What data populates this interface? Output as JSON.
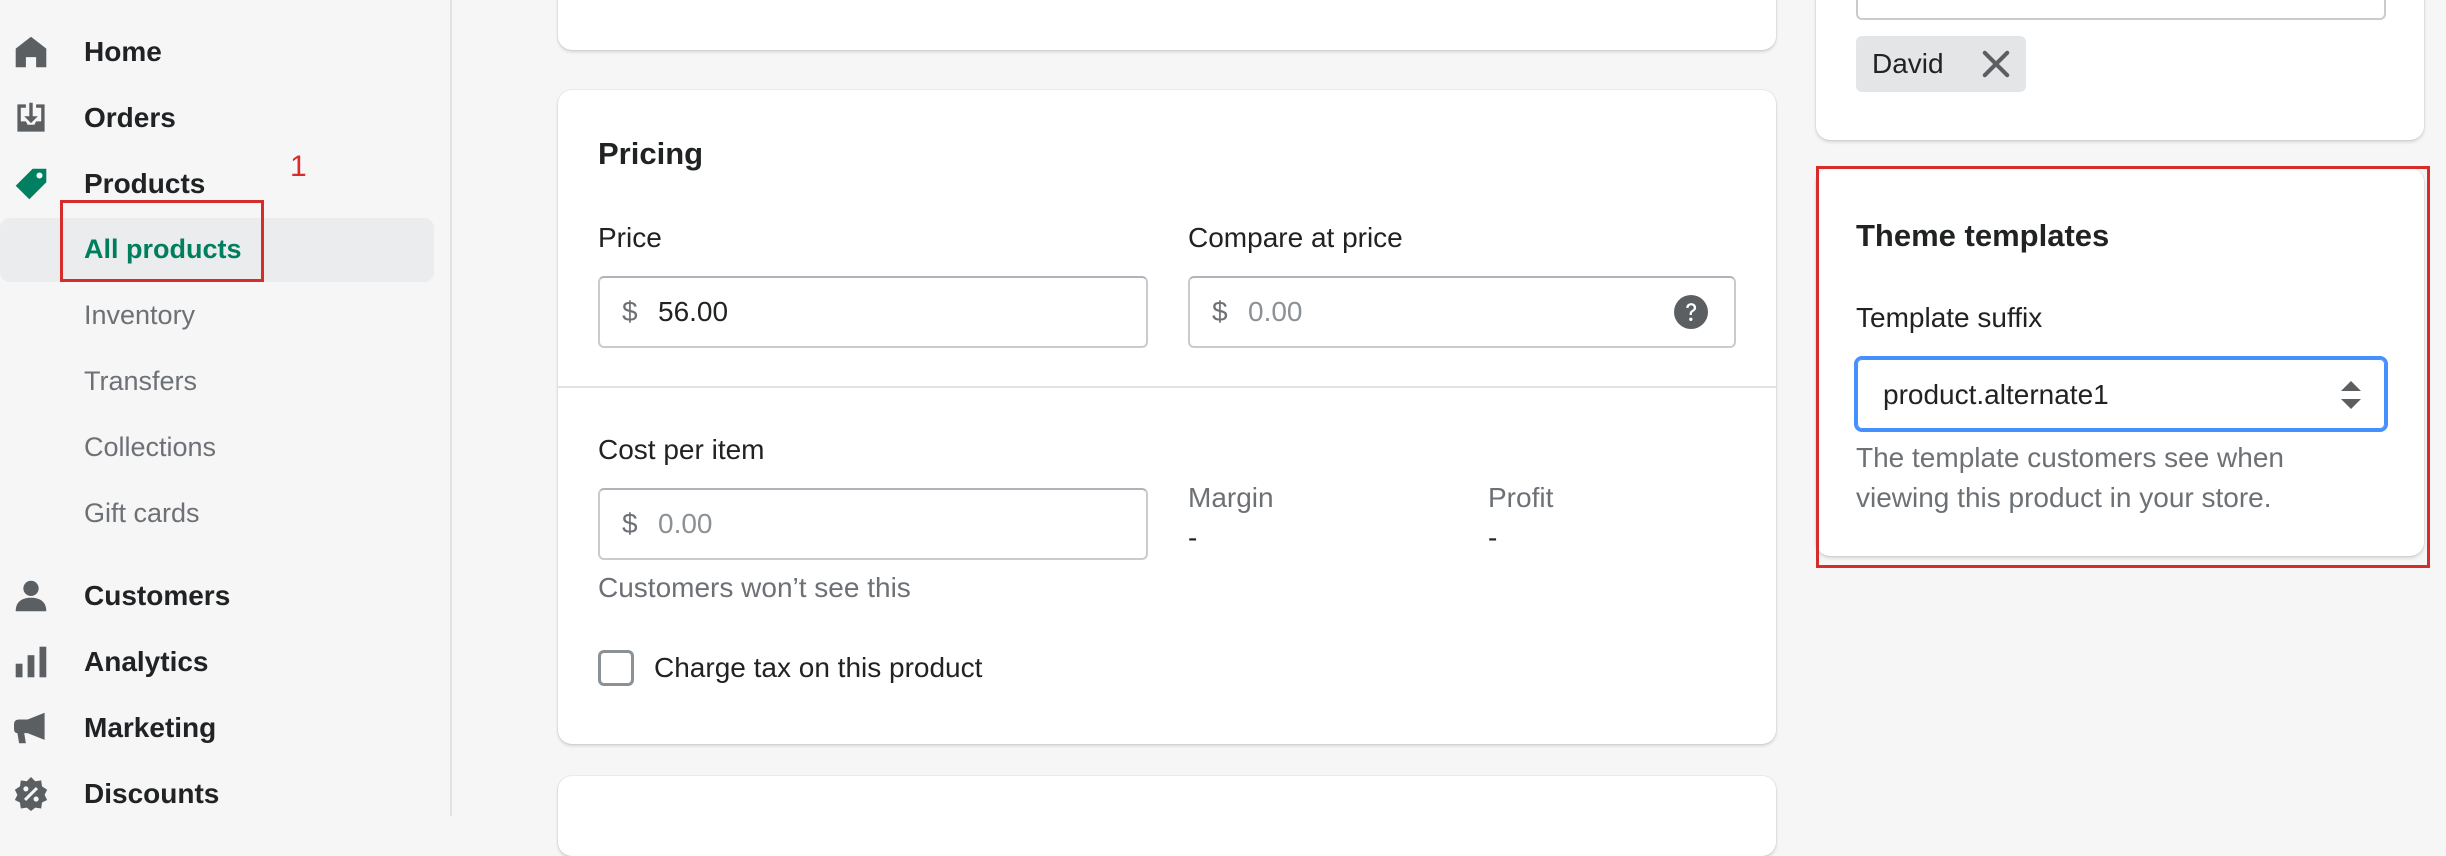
{
  "sidebar": {
    "items": [
      {
        "label": "Home",
        "icon": "home-icon"
      },
      {
        "label": "Orders",
        "icon": "orders-icon"
      },
      {
        "label": "Products",
        "icon": "tag-icon"
      },
      {
        "label": "Customers",
        "icon": "person-icon"
      },
      {
        "label": "Analytics",
        "icon": "bar-chart-icon"
      },
      {
        "label": "Marketing",
        "icon": "megaphone-icon"
      },
      {
        "label": "Discounts",
        "icon": "discount-icon"
      }
    ],
    "product_subitems": [
      {
        "label": "All products",
        "active": true
      },
      {
        "label": "Inventory"
      },
      {
        "label": "Transfers"
      },
      {
        "label": "Collections"
      },
      {
        "label": "Gift cards"
      }
    ],
    "active_color": "#007f5f",
    "annotation_number": "1"
  },
  "pricing": {
    "title": "Pricing",
    "price_label": "Price",
    "price_prefix": "$",
    "price_value": "56.00",
    "compare_label": "Compare at price",
    "compare_prefix": "$",
    "compare_placeholder": "0.00",
    "cost_label": "Cost per item",
    "cost_prefix": "$",
    "cost_placeholder": "0.00",
    "cost_help": "Customers won’t see this",
    "margin_label": "Margin",
    "margin_value": "-",
    "profit_label": "Profit",
    "profit_value": "-",
    "tax_label": "Charge tax on this product",
    "tax_checked": false
  },
  "tags": {
    "items": [
      {
        "label": "David"
      }
    ]
  },
  "theme_templates": {
    "title": "Theme templates",
    "suffix_label": "Template suffix",
    "selected_value": "product.alternate1",
    "help_line1": "The template customers see when",
    "help_line2": "viewing this product in your store."
  },
  "colors": {
    "annotation": "#d72c2c",
    "focus": "#458fff"
  }
}
